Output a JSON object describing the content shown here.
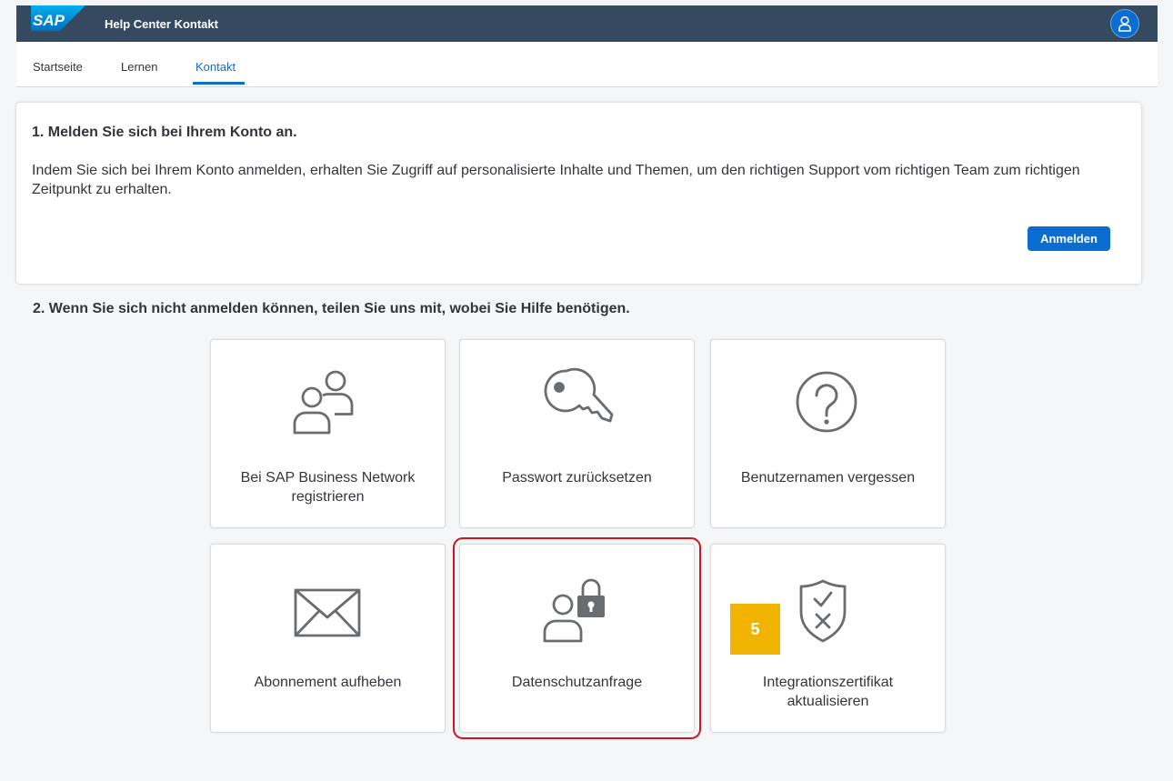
{
  "shellbar": {
    "logo_text": "SAP",
    "title": "Help Center Kontakt",
    "avatar_icon": "user-icon",
    "colors": {
      "background": "#354a5f",
      "accent": "#0a6ed1"
    }
  },
  "nav": {
    "items": [
      {
        "label": "Startseite",
        "active": false
      },
      {
        "label": "Lernen",
        "active": false
      },
      {
        "label": "Kontakt",
        "active": true
      }
    ]
  },
  "login_card": {
    "title": "1. Melden Sie sich bei Ihrem Konto an.",
    "text": "Indem Sie sich bei Ihrem Konto anmelden, erhalten Sie Zugriff auf personalisierte Inhalte und Themen, um den richtigen Support vom richtigen Team zum richtigen Zeitpunkt zu erhalten.",
    "button_label": "Anmelden"
  },
  "section2": {
    "title": "2. Wenn Sie sich nicht anmelden können, teilen Sie uns mit, wobei Sie Hilfe benötigen."
  },
  "tiles": [
    {
      "label": "Bei SAP Business Network registrieren",
      "icon": "users-icon"
    },
    {
      "label": "Passwort zurücksetzen",
      "icon": "key-icon"
    },
    {
      "label": "Benutzernamen vergessen",
      "icon": "question-circle-icon"
    },
    {
      "label": "Abonnement aufheben",
      "icon": "envelope-icon"
    },
    {
      "label": "Datenschutzanfrage",
      "icon": "user-lock-icon",
      "highlighted": true
    },
    {
      "label": "Integrationszertifikat aktualisieren",
      "icon": "shield-check-icon"
    }
  ],
  "step_badge": {
    "number": "5",
    "color": "#f0b400"
  }
}
